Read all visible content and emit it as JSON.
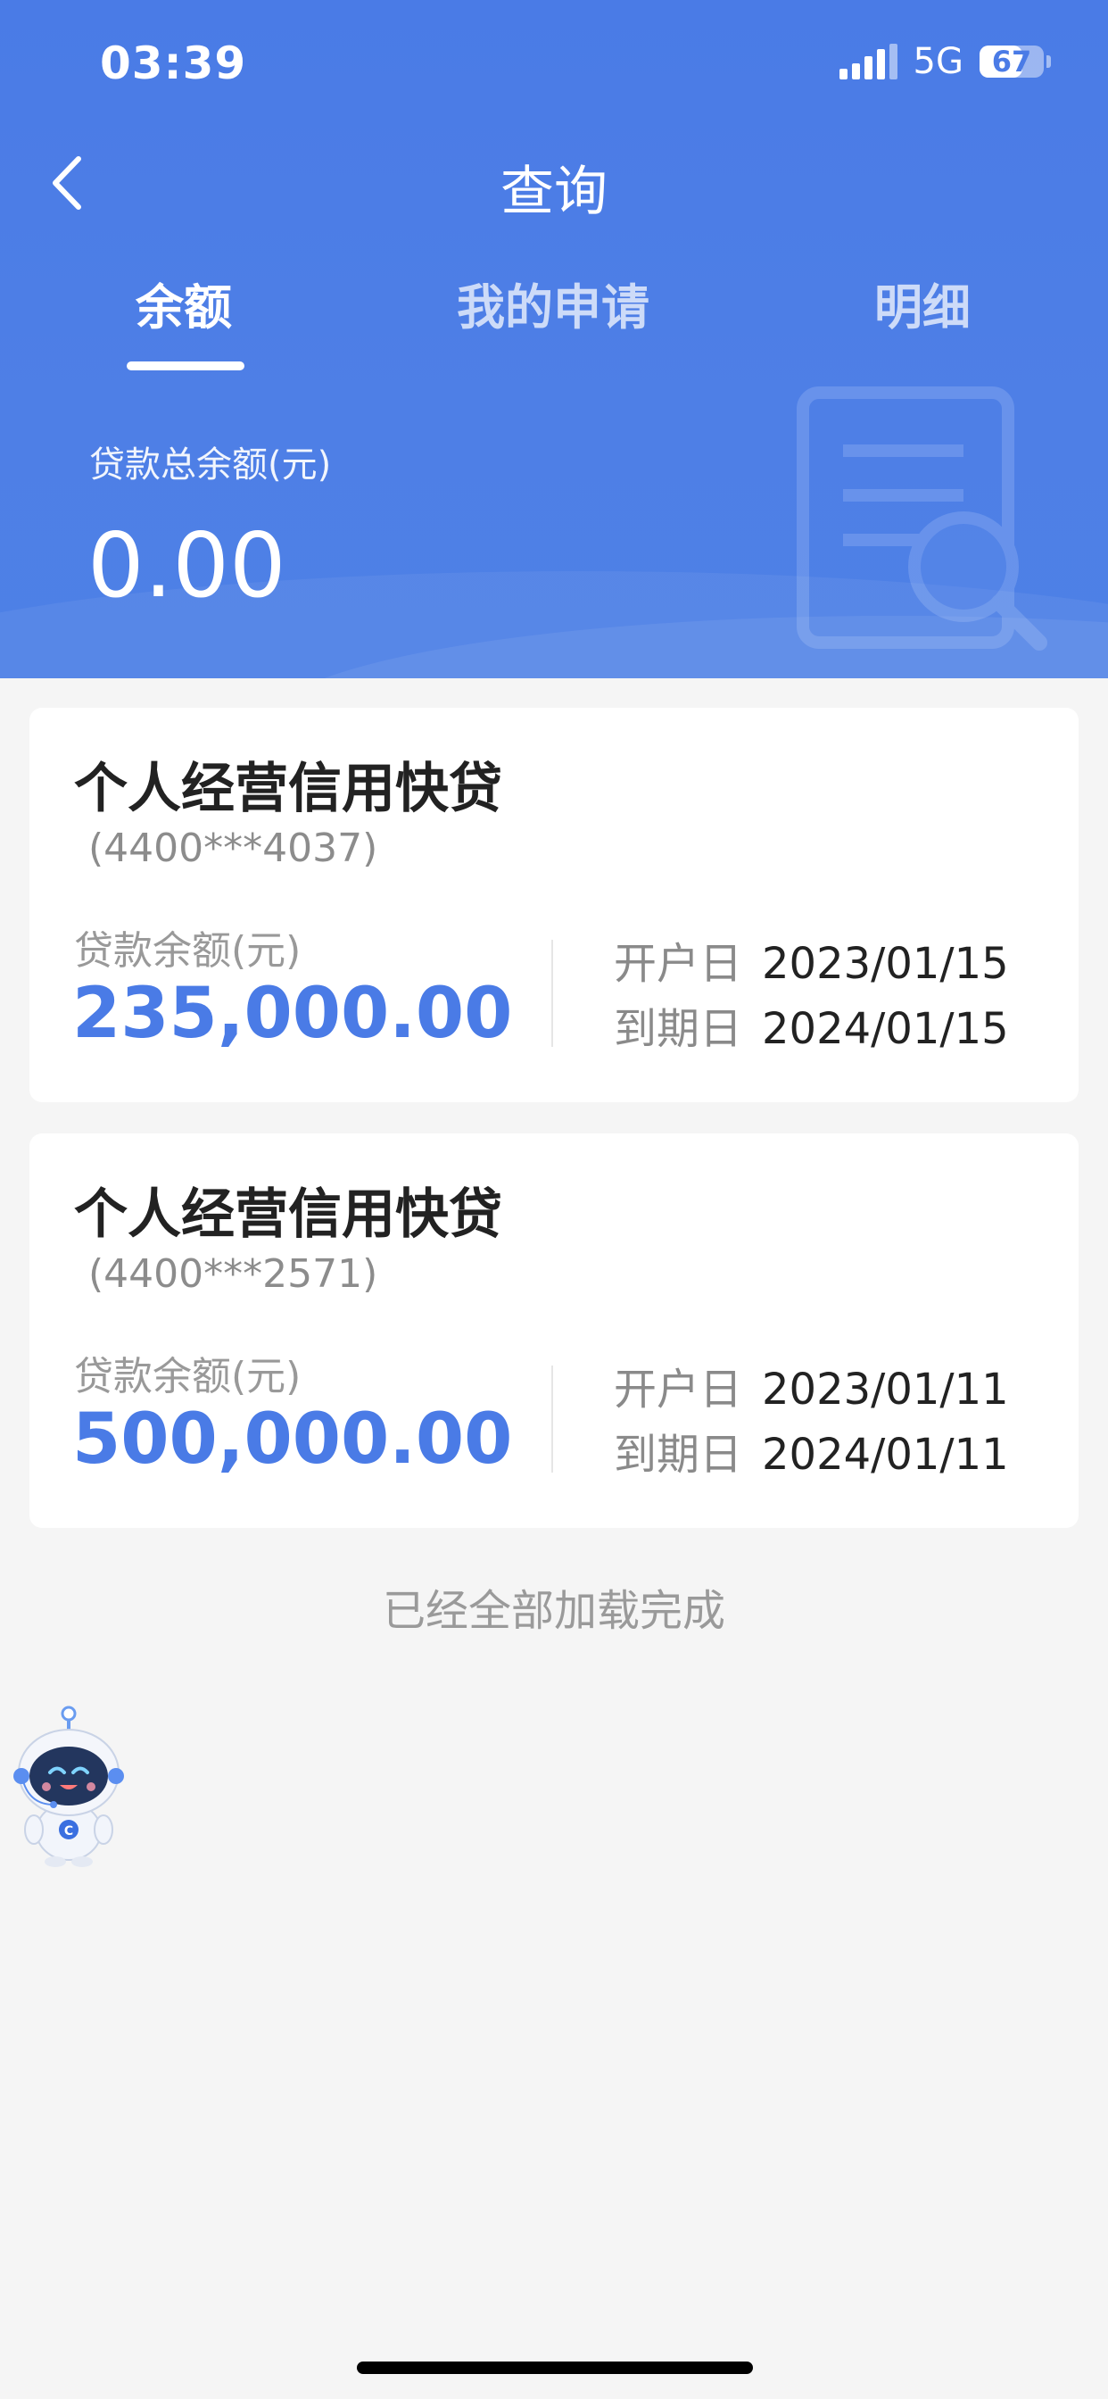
{
  "status_bar": {
    "time": "03:39",
    "network": "5G",
    "battery": "67",
    "battery_fraction": 0.67
  },
  "header": {
    "title": "查询",
    "tabs": [
      {
        "label": "余额",
        "active": true
      },
      {
        "label": "我的申请",
        "active": false
      },
      {
        "label": "明细",
        "active": false
      }
    ],
    "total_label": "贷款总余额(元)",
    "total_value": "0.00"
  },
  "loans": [
    {
      "name": "个人经营信用快贷",
      "account": "(4400***4037)",
      "balance_label": "贷款余额(元)",
      "balance": "235,000.00",
      "open_label": "开户日",
      "open_date": "2023/01/15",
      "due_label": "到期日",
      "due_date": "2024/01/15"
    },
    {
      "name": "个人经营信用快贷",
      "account": "(4400***2571)",
      "balance_label": "贷款余额(元)",
      "balance": "500,000.00",
      "open_label": "开户日",
      "open_date": "2023/01/11",
      "due_label": "到期日",
      "due_date": "2024/01/11"
    }
  ],
  "footer": {
    "load_complete": "已经全部加载完成"
  },
  "icons": [
    "back-icon",
    "signal-icon",
    "battery-icon",
    "document-search-icon",
    "assistant-robot-icon"
  ],
  "colors": {
    "primary": "#4a7be6",
    "background": "#f5f5f5",
    "card": "#ffffff"
  }
}
